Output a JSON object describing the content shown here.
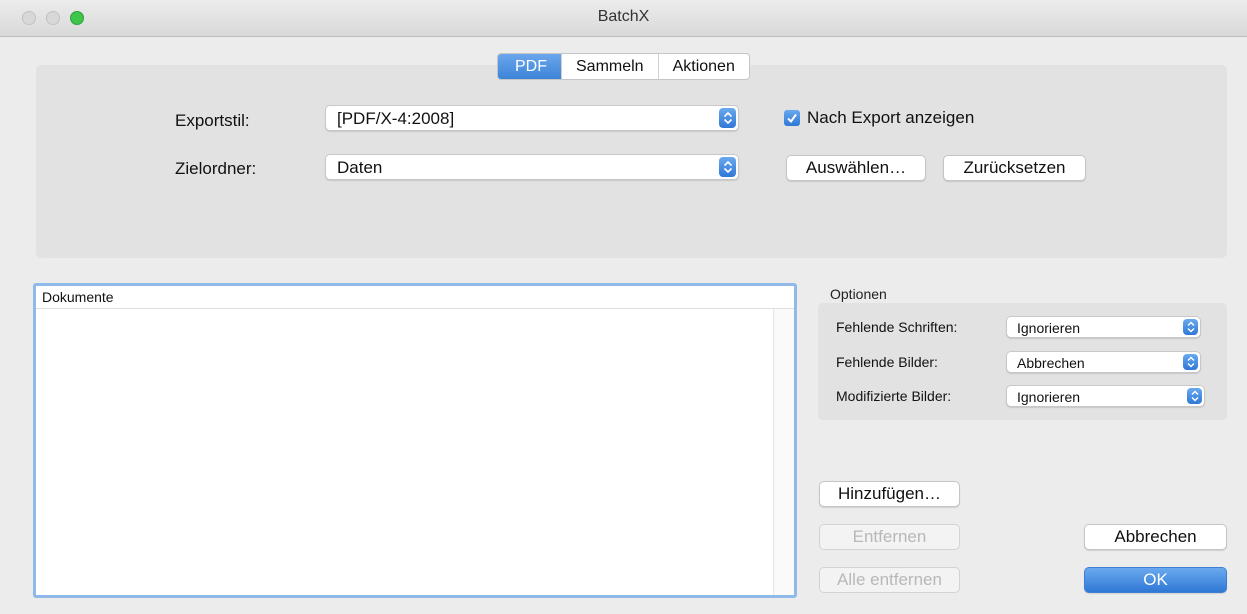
{
  "window": {
    "title": "BatchX"
  },
  "tabs": [
    {
      "label": "PDF",
      "active": true
    },
    {
      "label": "Sammeln",
      "active": false
    },
    {
      "label": "Aktionen",
      "active": false
    }
  ],
  "export": {
    "style_label": "Exportstil:",
    "style_value": "[PDF/X-4:2008]",
    "show_after_export_label": "Nach Export anzeigen",
    "show_after_export_checked": true,
    "folder_label": "Zielordner:",
    "folder_value": "Daten",
    "choose_button": "Auswählen…",
    "reset_button": "Zurücksetzen"
  },
  "documents": {
    "header": "Dokumente",
    "items": []
  },
  "options": {
    "title": "Optionen",
    "rows": [
      {
        "label": "Fehlende Schriften:",
        "value": "Ignorieren"
      },
      {
        "label": "Fehlende Bilder:",
        "value": "Abbrechen"
      },
      {
        "label": "Modifizierte Bilder:",
        "value": "Ignorieren"
      }
    ]
  },
  "actions": {
    "add": "Hinzufügen…",
    "remove": "Entfernen",
    "remove_all": "Alle entfernen",
    "cancel": "Abbrechen",
    "ok": "OK"
  },
  "colors": {
    "accent": "#3d84d8",
    "focus_ring": "#8fb9e9",
    "traffic_green": "#3ec54a"
  }
}
